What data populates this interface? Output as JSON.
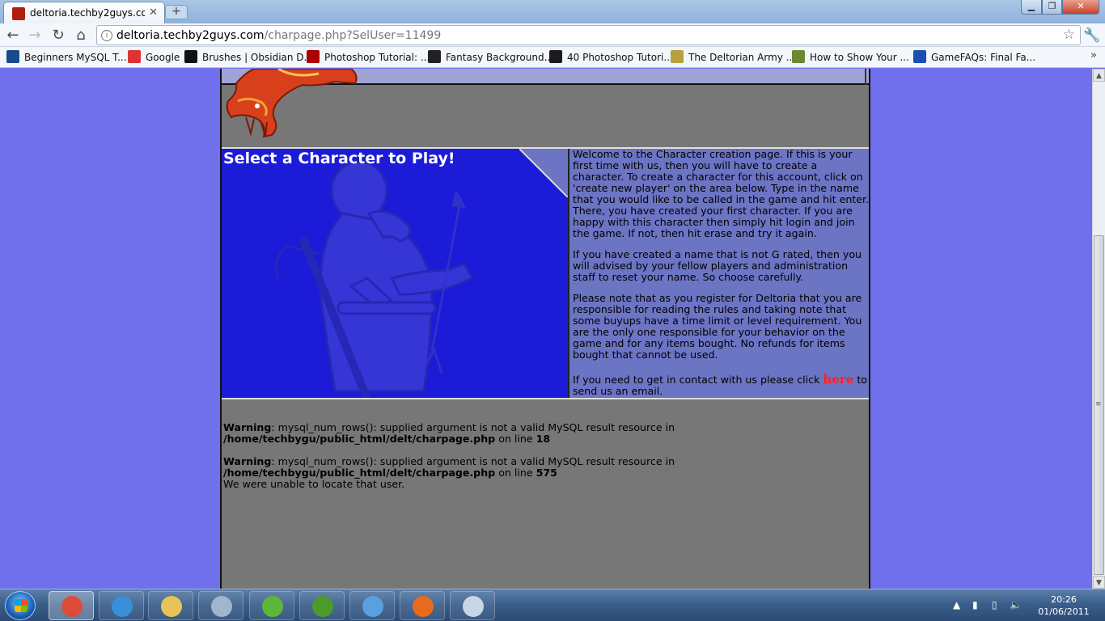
{
  "browser": {
    "tab_title": "deltoria.techby2guys.co...",
    "new_tab_label": "+",
    "url_host": "deltoria.techby2guys.com",
    "url_path": "/charpage.php?SelUser=11499"
  },
  "bookmarks": [
    {
      "label": "Beginners MySQL T...",
      "icon": "mysql-icon",
      "color": "#1a4a8a"
    },
    {
      "label": "Google",
      "icon": "google-icon",
      "color": "#d33"
    },
    {
      "label": "Brushes | Obsidian D...",
      "icon": "obsidian-icon",
      "color": "#111"
    },
    {
      "label": "Photoshop Tutorial: ...",
      "icon": "photoshop-icon",
      "color": "#a00"
    },
    {
      "label": "Fantasy Background...",
      "icon": "fantasy-icon",
      "color": "#222"
    },
    {
      "label": "40 Photoshop Tutori...",
      "icon": "v-icon",
      "color": "#1b1b1b"
    },
    {
      "label": "The Deltorian Army ...",
      "icon": "deltorian-icon",
      "color": "#b8a040"
    },
    {
      "label": "How to Show Your ...",
      "icon": "howto-icon",
      "color": "#6a8a30"
    },
    {
      "label": "GameFAQs: Final Fa...",
      "icon": "gamefaqs-icon",
      "color": "#1b4fb3"
    }
  ],
  "page": {
    "title": "Select a Character to Play!",
    "intro_paragraphs": [
      "Welcome to the Character creation page. If this is your first time with us, then you will have to create a character. To create a character for this account, click on 'create new player' on the area below. Type in the name that you would like to be called in the game and hit enter. There, you have created your first character. If you are happy with this character then simply hit login and join the game. If not, then hit erase and try it again.",
      "If you have created a name that is not G rated, then you will advised by your fellow players and administration staff to reset your name. So choose carefully.",
      "Please note that as you register for Deltoria that you are responsible for reading the rules and taking note that some buyups have a time limit or level requirement. You are the only one responsible for your behavior on the game and for any items bought. No refunds for items bought that cannot be used."
    ],
    "contact_before": "If you need to get in contact with us please click ",
    "contact_link": "here",
    "contact_after": " to send us an email.",
    "warnings": [
      {
        "label": "Warning",
        "message": ": mysql_num_rows(): supplied argument is not a valid MySQL result resource in ",
        "path": "/home/techbygu/public_html/delt/charpage.php",
        "on_line": " on line ",
        "line": "18"
      },
      {
        "label": "Warning",
        "message": ": mysql_num_rows(): supplied argument is not a valid MySQL result resource in ",
        "path": "/home/techbygu/public_html/delt/charpage.php",
        "on_line": " on line ",
        "line": "575"
      }
    ],
    "error_message": "We were unable to locate that user."
  },
  "taskbar": {
    "apps": [
      {
        "name": "chrome-icon",
        "color": "#dd4b39",
        "active": true
      },
      {
        "name": "safari-icon",
        "color": "#3a8fd9",
        "active": false
      },
      {
        "name": "explorer-icon",
        "color": "#e8c35a",
        "active": false
      },
      {
        "name": "calculator-icon",
        "color": "#9fb6cc",
        "active": false
      },
      {
        "name": "windows-icon",
        "color": "#5cb83a",
        "active": false
      },
      {
        "name": "utorrent-icon",
        "color": "#4c9a2a",
        "active": false
      },
      {
        "name": "messenger-icon",
        "color": "#5aa0e0",
        "active": false
      },
      {
        "name": "firefox-icon",
        "color": "#e86a1c",
        "active": false
      },
      {
        "name": "paint-icon",
        "color": "#c9d6e6",
        "active": false
      }
    ],
    "time": "20:26",
    "date": "01/06/2011"
  },
  "colors": {
    "page_background": "#7070ec",
    "content_background": "#777777",
    "panel_blue": "#1b1bd8",
    "link_red": "#ff1f1f"
  }
}
